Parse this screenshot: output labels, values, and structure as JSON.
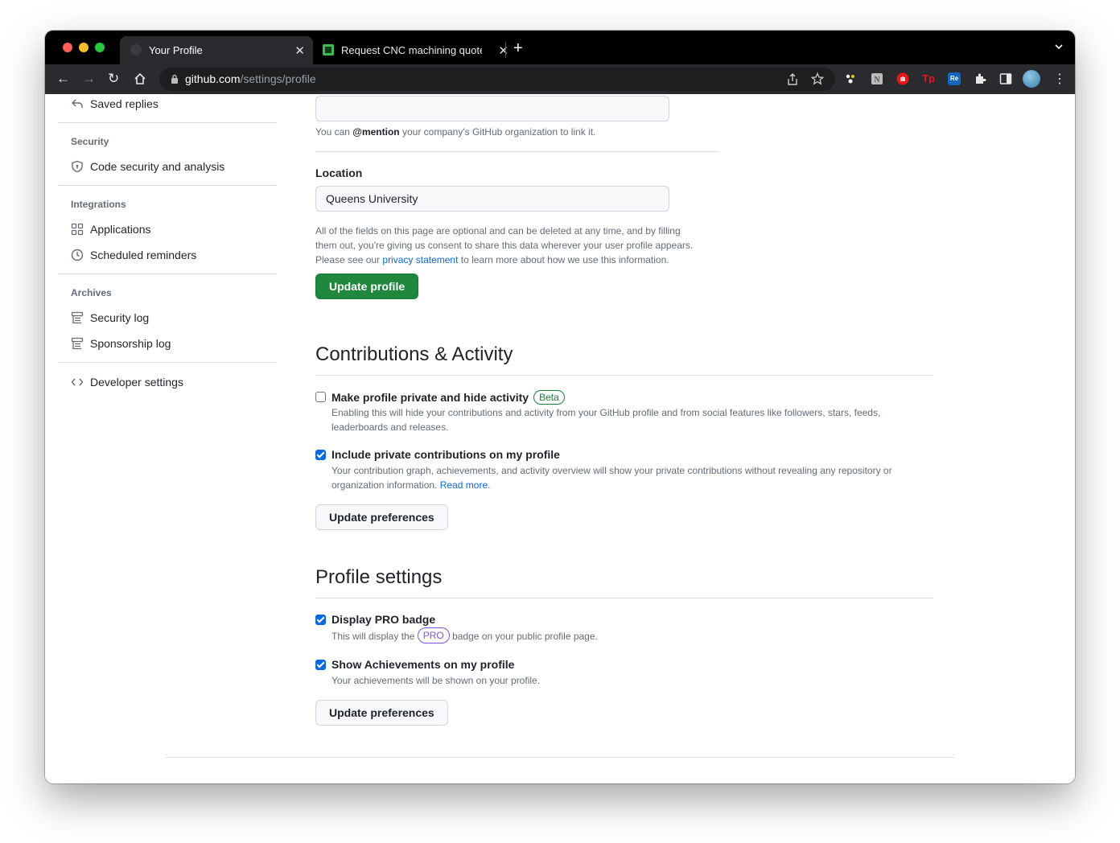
{
  "browser": {
    "tabs": [
      {
        "title": "Your Profile",
        "active": true
      },
      {
        "title": "Request CNC machining quote",
        "active": false
      }
    ],
    "close_glyph": "✕",
    "new_tab_glyph": "+",
    "tab_menu_glyph": "⌄",
    "url_host": "github.com",
    "url_path": "/settings/profile",
    "nav": {
      "back": "←",
      "forward": "→",
      "reload": "↻",
      "home": "⌂"
    },
    "extensions": [
      "grammar-extension-icon",
      "notion-extension-icon",
      "adblock-extension-icon",
      "tp-extension-icon",
      "re-extension-icon",
      "puzzle-icon",
      "sidepanel-icon"
    ],
    "ext_labels": {
      "tp": "Tp",
      "re": "Re"
    },
    "kebab": "⋮"
  },
  "sidebar": {
    "saved_replies": "Saved replies",
    "security_heading": "Security",
    "code_security": "Code security and analysis",
    "integrations_heading": "Integrations",
    "applications": "Applications",
    "scheduled_reminders": "Scheduled reminders",
    "archives_heading": "Archives",
    "security_log": "Security log",
    "sponsorship_log": "Sponsorship log",
    "developer_settings": "Developer settings"
  },
  "profile_form": {
    "company_value": "",
    "company_note_pre": "You can ",
    "company_note_mention": "@mention",
    "company_note_post": " your company's GitHub organization to link it.",
    "location_label": "Location",
    "location_value": "Queens University",
    "disclaimer_line1": "All of the fields on this page are optional and can be deleted at any time, and by filling",
    "disclaimer_line2": "them out, you're giving us consent to share this data wherever your user profile appears.",
    "disclaimer_line3_pre": "Please see our ",
    "privacy_link": "privacy statement",
    "disclaimer_line3_post": " to learn more about how we use this information.",
    "update_profile": "Update profile"
  },
  "contributions": {
    "heading": "Contributions & Activity",
    "private": {
      "title": "Make profile private and hide activity",
      "badge": "Beta",
      "checked": false,
      "desc_line1": "Enabling this will hide your contributions and activity from your GitHub profile and from social features like followers, stars, feeds,",
      "desc_line2": "leaderboards and releases."
    },
    "include_private": {
      "title": "Include private contributions on my profile",
      "checked": true,
      "desc_line1": "Your contribution graph, achievements, and activity overview will show your private contributions without revealing any repository or",
      "desc_line2_pre": "organization information. ",
      "read_more": "Read more",
      "desc_line2_post": "."
    },
    "update_button": "Update preferences"
  },
  "profile_settings": {
    "heading": "Profile settings",
    "pro_badge": {
      "title": "Display PRO badge",
      "checked": true,
      "desc_pre": "This will display the ",
      "badge": "PRO",
      "desc_post": " badge on your public profile page."
    },
    "achievements": {
      "title": "Show Achievements on my profile",
      "checked": true,
      "desc": "Your achievements will be shown on your profile."
    },
    "update_button": "Update preferences"
  },
  "colors": {
    "primary_button": "#1f883d",
    "link": "#0969da",
    "beta": "#1a7f37",
    "pro": "#8250df"
  }
}
